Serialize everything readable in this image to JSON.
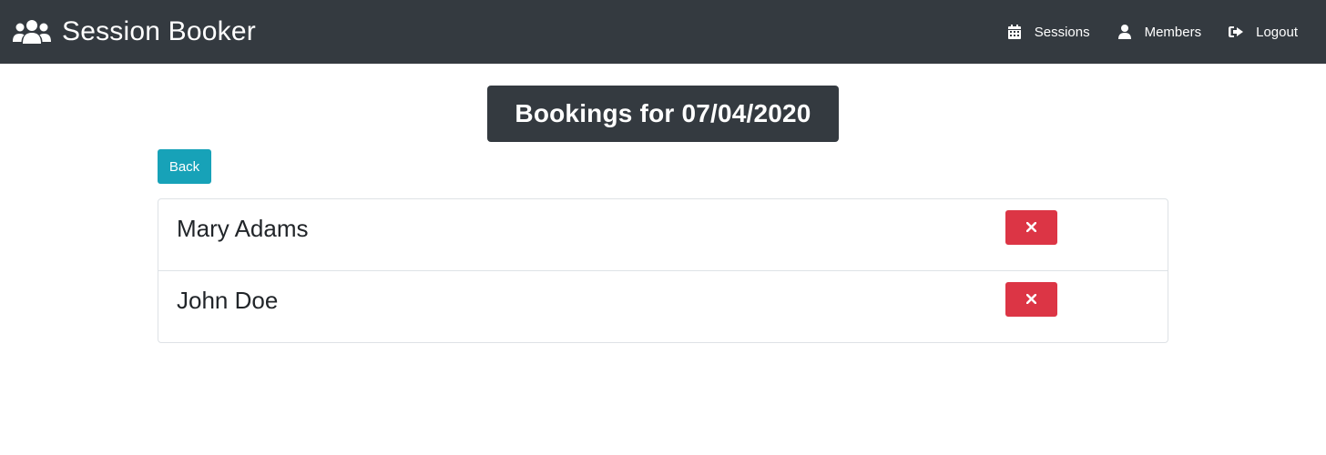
{
  "navbar": {
    "brand_text": "Session Booker",
    "brand_icon": "users-icon",
    "links": [
      {
        "label": "Sessions",
        "icon": "calendar-icon"
      },
      {
        "label": "Members",
        "icon": "user-icon"
      },
      {
        "label": "Logout",
        "icon": "sign-out-icon"
      }
    ]
  },
  "page": {
    "title": "Bookings for 07/04/2020",
    "back_label": "Back"
  },
  "bookings": [
    {
      "name": "Mary Adams",
      "action_icon": "times-icon"
    },
    {
      "name": "John Doe",
      "action_icon": "times-icon"
    }
  ],
  "colors": {
    "navbar_bg": "#343a40",
    "back_button": "#17a2b8",
    "delete_button": "#dc3545"
  }
}
